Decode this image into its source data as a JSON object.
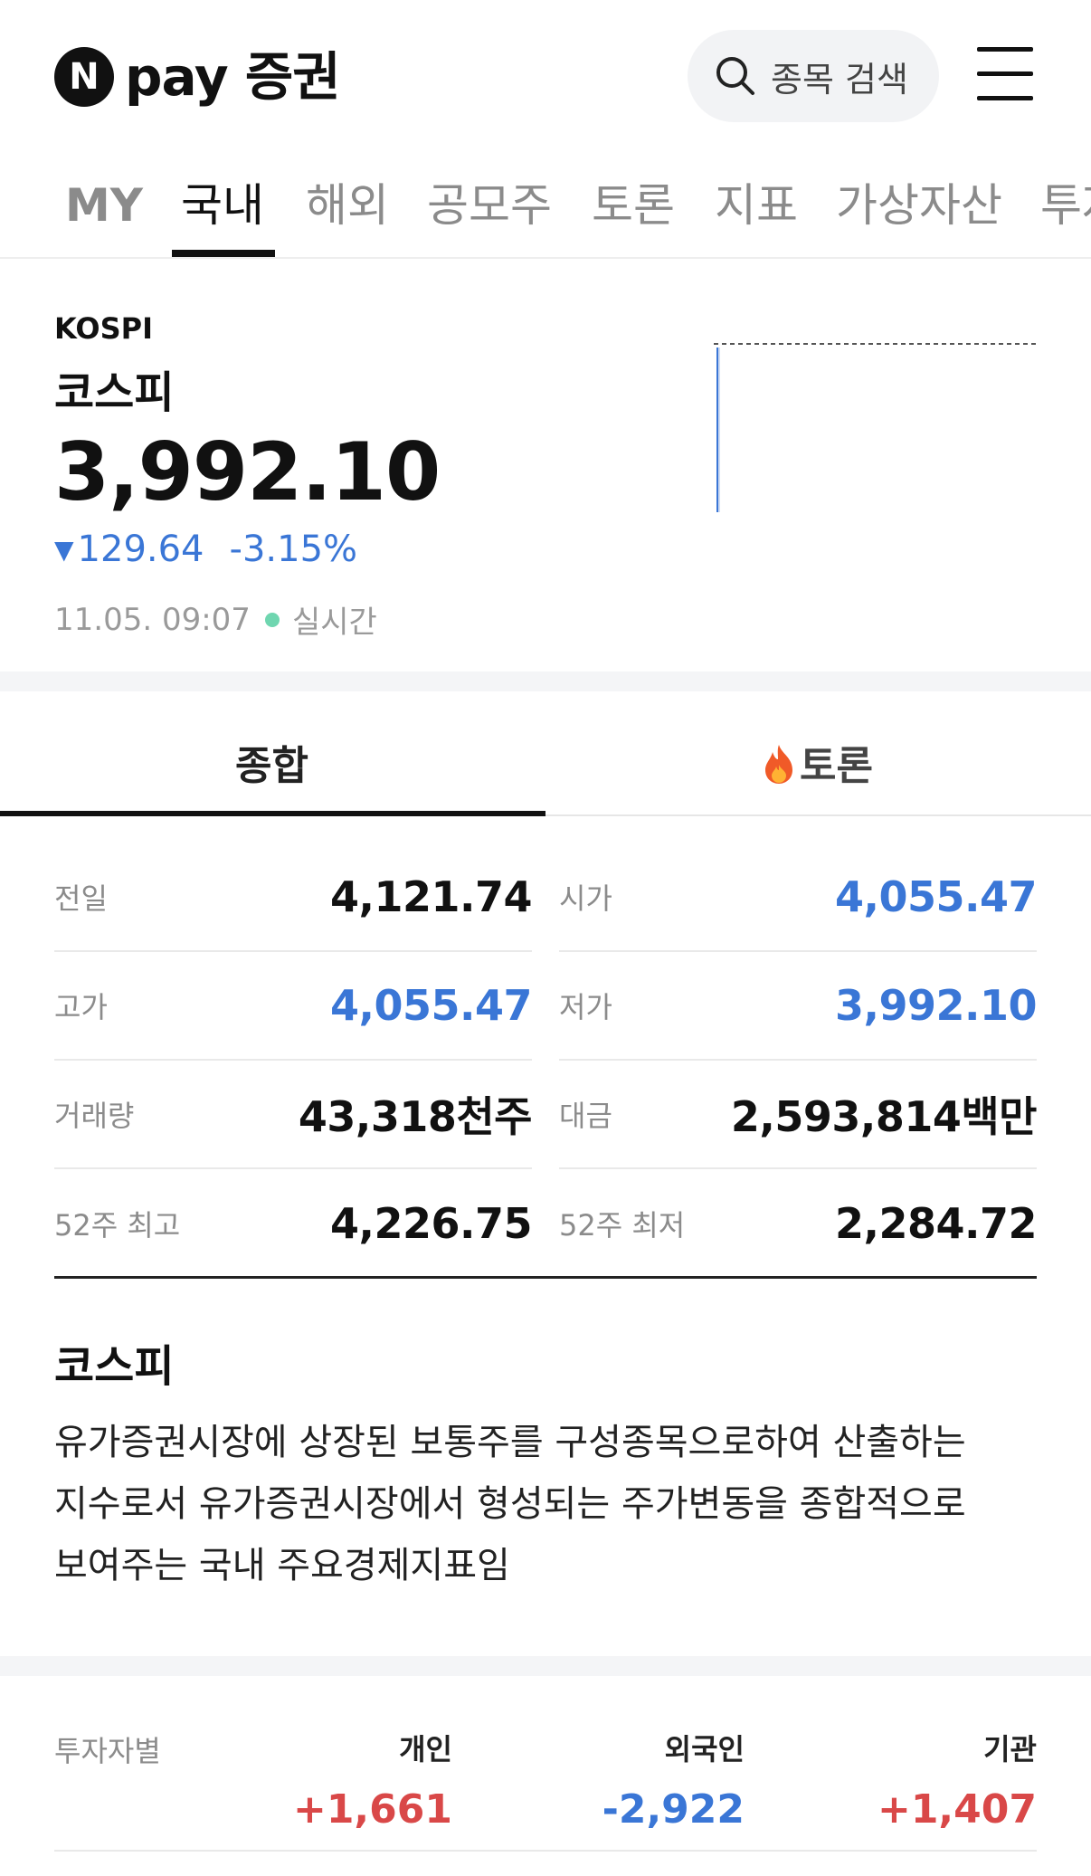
{
  "header": {
    "logo_mark": "N",
    "logo_text": "pay 증권",
    "search_placeholder": "종목 검색"
  },
  "nav": {
    "tabs": [
      "MY",
      "국내",
      "해외",
      "공모주",
      "토론",
      "지표",
      "가상자산",
      "투자"
    ],
    "active_index": 1
  },
  "index": {
    "code": "KOSPI",
    "name": "코스피",
    "price": "3,992.10",
    "change": "129.64",
    "change_pct": "-3.15%",
    "direction": "down",
    "time": "11.05. 09:07",
    "status": "실시간"
  },
  "subtabs": {
    "overview": "종합",
    "discussion": "토론"
  },
  "stats": [
    {
      "label": "전일",
      "value": "4,121.74",
      "color": "default"
    },
    {
      "label": "시가",
      "value": "4,055.47",
      "color": "blue"
    },
    {
      "label": "고가",
      "value": "4,055.47",
      "color": "blue"
    },
    {
      "label": "저가",
      "value": "3,992.10",
      "color": "blue"
    },
    {
      "label": "거래량",
      "value": "43,318천주",
      "color": "default"
    },
    {
      "label": "대금",
      "value": "2,593,814백만",
      "color": "default"
    },
    {
      "label": "52주 최고",
      "value": "4,226.75",
      "color": "default"
    },
    {
      "label": "52주 최저",
      "value": "2,284.72",
      "color": "default"
    }
  ],
  "description": {
    "title": "코스피",
    "lines": [
      "유가증권시장에 상장된 보통주를 구성종목으로하여 산출하는",
      "지수로서 유가증권시장에서 형성되는 주가변동을 종합적으로",
      "보여주는 국내 주요경제지표임"
    ]
  },
  "investors": {
    "label": "투자자별",
    "columns": [
      {
        "name": "개인",
        "value": "+1,661",
        "color": "red"
      },
      {
        "name": "외국인",
        "value": "-2,922",
        "color": "blue"
      },
      {
        "name": "기관",
        "value": "+1,407",
        "color": "red"
      }
    ]
  },
  "colors": {
    "down_blue": "#3a76d6",
    "up_red": "#d94848",
    "live_dot": "#6fd6b0"
  }
}
